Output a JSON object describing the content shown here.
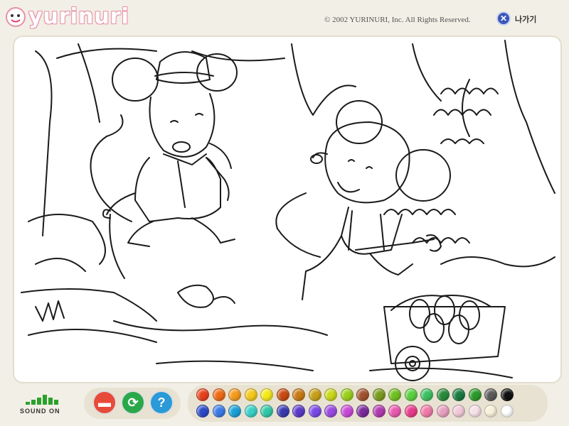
{
  "header": {
    "logo_text": "yurinuri",
    "copyright": "© 2002 YURINURI, Inc. All Rights Reserved.",
    "exit_icon": "close-icon",
    "exit_label": "나가기"
  },
  "toolbar": {
    "sound_label": "SOUND ON",
    "print_icon": "print-icon",
    "reset_icon": "refresh-icon",
    "help_icon": "help-icon",
    "help_glyph": "?"
  },
  "palette": {
    "row1": [
      "#e8401c",
      "#f06a14",
      "#f59a1c",
      "#f5c81a",
      "#f5e81a",
      "#c84a10",
      "#c87a14",
      "#c8a018",
      "#c8d81a",
      "#9ad01a",
      "#a0522d",
      "#7a9a20",
      "#70c020",
      "#5ad040",
      "#3ac060",
      "#2a8a3a",
      "#1a7a40",
      "#2a9a2a",
      "#5a5a5a",
      "#101010"
    ],
    "row2": [
      "#2a4ac8",
      "#3a7ae8",
      "#1aa0d8",
      "#3ad0c8",
      "#30c8a8",
      "#3a3ab0",
      "#5a3ac8",
      "#7a4ae8",
      "#9a4ae0",
      "#c84ad8",
      "#7a2a9a",
      "#b03ab0",
      "#e85ab0",
      "#e83a8a",
      "#f07aa8",
      "#e8a0c0",
      "#f0c8d8",
      "#f8e0e8",
      "#f8f0d8",
      "#ffffff"
    ]
  }
}
